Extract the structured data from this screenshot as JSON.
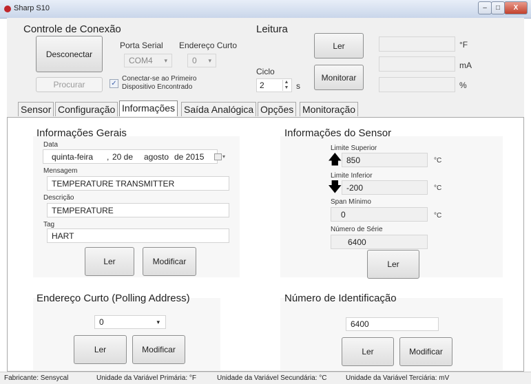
{
  "window": {
    "title": "Sharp S10",
    "min_label": "–",
    "max_label": "□",
    "close_label": "X"
  },
  "connection": {
    "title": "Controle de Conexão",
    "disconnect_label": "Desconectar",
    "serial_label": "Porta Serial",
    "serial_value": "COM4",
    "address_label": "Endereço Curto",
    "address_value": "0",
    "search_label": "Procurar",
    "connect_first_label_1": "Conectar-se ao Primeiro",
    "connect_first_label_2": "Dispositivo Encontrado",
    "connect_first_checked": true
  },
  "reading": {
    "title": "Leitura",
    "read_label": "Ler",
    "cycle_label": "Ciclo",
    "cycle_value": "2",
    "cycle_unit": "s",
    "monitor_label": "Monitorar",
    "unit_1": "°F",
    "unit_2": "mA",
    "unit_3": "%"
  },
  "tabs": [
    "Sensor",
    "Configuração",
    "Informações",
    "Saída Analógica",
    "Opções",
    "Monitoração"
  ],
  "active_tab": "Informações",
  "general_info": {
    "title": "Informações Gerais",
    "date_label": "Data",
    "date_weekday": "quinta-feira",
    "date_day": "20 de",
    "date_month": "agosto",
    "date_year": "de 2015",
    "message_label": "Mensagem",
    "message_value": "TEMPERATURE TRANSMITTER",
    "description_label": "Descrição",
    "description_value": "TEMPERATURE",
    "tag_label": "Tag",
    "tag_value": "HART",
    "read_label": "Ler",
    "modify_label": "Modificar"
  },
  "sensor_info": {
    "title": "Informações do Sensor",
    "upper_label": "Limite Superior",
    "upper_value": "850",
    "upper_unit": "°C",
    "lower_label": "Limite Inferior",
    "lower_value": "-200",
    "lower_unit": "°C",
    "span_label": "Span Mínimo",
    "span_value": "0",
    "span_unit": "°C",
    "serial_label": "Número de Série",
    "serial_value": "6400",
    "read_label": "Ler"
  },
  "polling": {
    "title": "Endereço Curto (Polling Address)",
    "value": "0",
    "read_label": "Ler",
    "modify_label": "Modificar"
  },
  "identification": {
    "title": "Número de Identificação",
    "value": "6400",
    "read_label": "Ler",
    "modify_label": "Modificar"
  },
  "status": {
    "manufacturer": "Fabricante: Sensycal",
    "primary_unit": "Unidade da Variável Primária: °F",
    "secondary_unit": "Unidade da Variável Secundária: °C",
    "tertiary_unit": "Unidade da Variável Terciária: mV"
  },
  "icons": {
    "app": "app-dot-icon",
    "calendar": "calendar-dropdown-icon",
    "arrow_up": "arrow-up-icon",
    "arrow_down": "arrow-down-icon"
  },
  "colors": {
    "app_icon": "#c0262b",
    "title_bar": "#c9d6ea",
    "close_button": "#c2412d"
  }
}
